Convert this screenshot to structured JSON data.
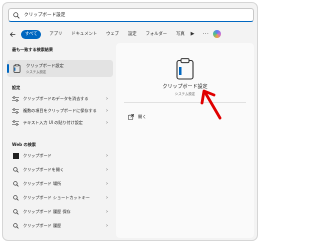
{
  "search": {
    "query": "クリップボード設定"
  },
  "tabs": {
    "items": [
      "すべて",
      "アプリ",
      "ドキュメント",
      "ウェブ",
      "設定",
      "フォルダー",
      "写真"
    ],
    "more": "▶"
  },
  "left": {
    "best_match_header": "最も一致する検索結果",
    "best_match": {
      "title": "クリップボード設定",
      "subtitle": "システム設定"
    },
    "settings_header": "設定",
    "settings_items": [
      "クリップボードのデータを消去する",
      "複数の項目をクリップボードに保存する",
      "テキスト入力 UI の貼り付け設定"
    ],
    "web_header": "Web の検索",
    "web_items": [
      "クリップボード",
      "クリップボードを開く",
      "クリップボード 場所",
      "クリップボード ショートカットキー",
      "クリップボード 履歴 保存",
      "クリップボード 履歴"
    ]
  },
  "right": {
    "title": "クリップボード設定",
    "subtitle": "システム設定",
    "open_label": "開く"
  },
  "colors": {
    "accent": "#0067c0",
    "annotation_arrow": "#e00000"
  }
}
